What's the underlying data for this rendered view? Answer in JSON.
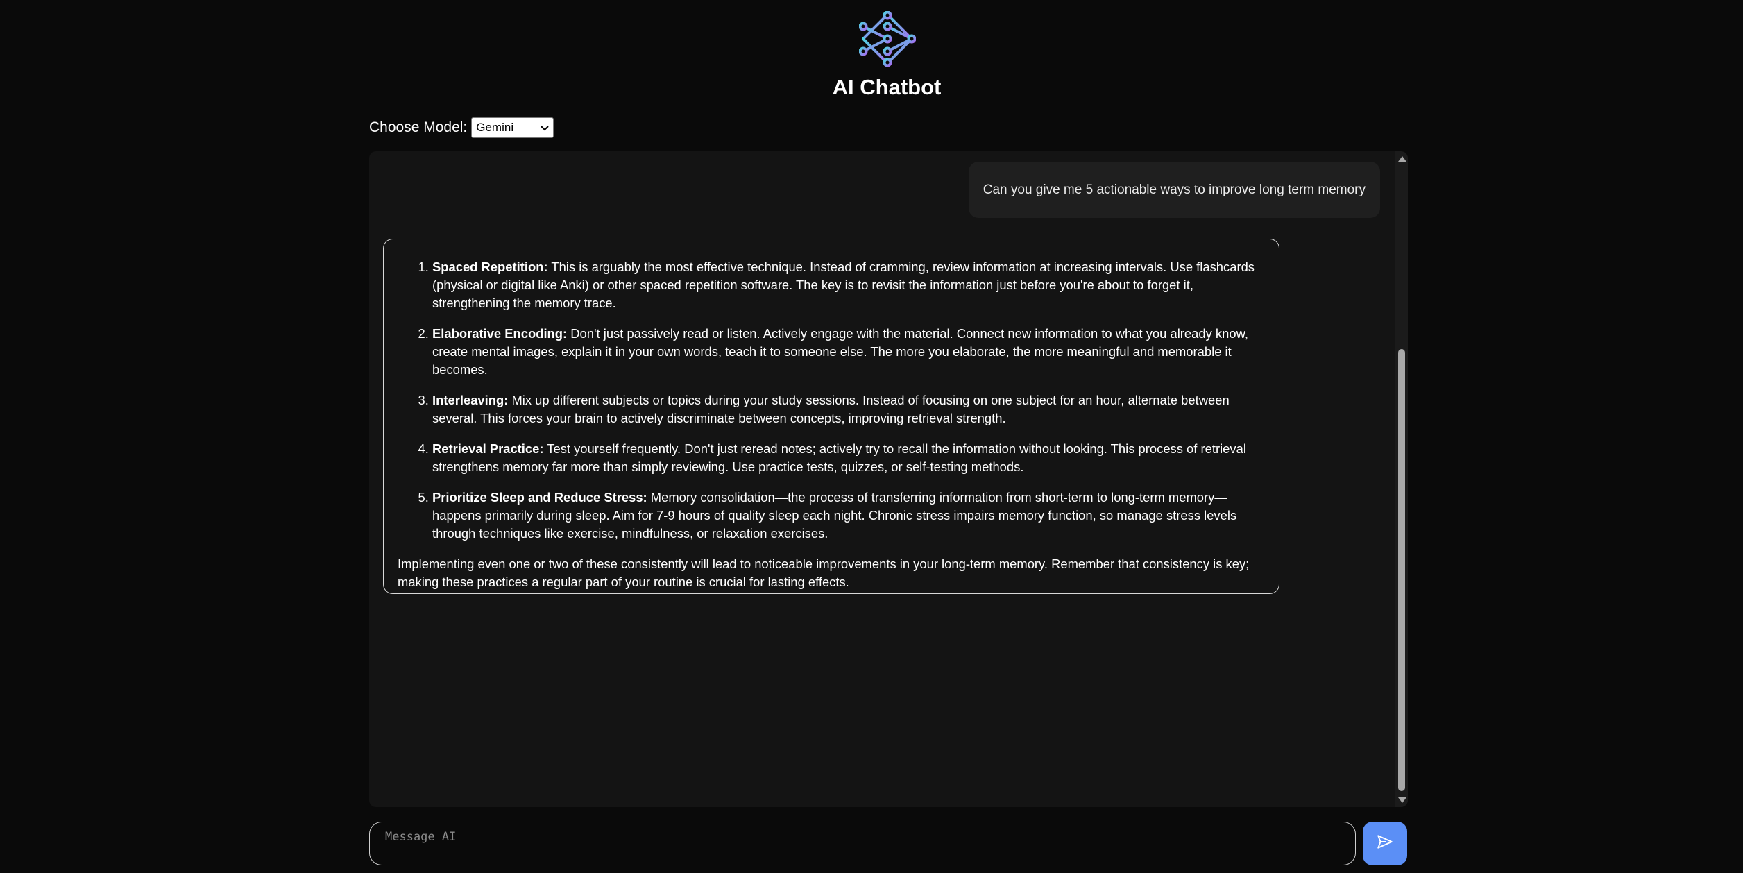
{
  "header": {
    "title": "AI Chatbot",
    "logo_icon": "neural-network-logo-icon"
  },
  "model_selector": {
    "label": "Choose Model:",
    "selected": "Gemini",
    "icon": "chevron-down-icon"
  },
  "chat": {
    "user_message": "Can you give me 5 actionable ways to improve long term memory",
    "ai_response": {
      "items": [
        {
          "title": "Spaced Repetition:",
          "text": " This is arguably the most effective technique. Instead of cramming, review information at increasing intervals. Use flashcards (physical or digital like Anki) or other spaced repetition software. The key is to revisit the information just before you're about to forget it, strengthening the memory trace."
        },
        {
          "title": "Elaborative Encoding:",
          "text": " Don't just passively read or listen. Actively engage with the material. Connect new information to what you already know, create mental images, explain it in your own words, teach it to someone else. The more you elaborate, the more meaningful and memorable it becomes."
        },
        {
          "title": "Interleaving:",
          "text": " Mix up different subjects or topics during your study sessions. Instead of focusing on one subject for an hour, alternate between several. This forces your brain to actively discriminate between concepts, improving retrieval strength."
        },
        {
          "title": "Retrieval Practice:",
          "text": " Test yourself frequently. Don't just reread notes; actively try to recall the information without looking. This process of retrieval strengthens memory far more than simply reviewing. Use practice tests, quizzes, or self-testing methods."
        },
        {
          "title": "Prioritize Sleep and Reduce Stress:",
          "text": " Memory consolidation—the process of transferring information from short-term to long-term memory—happens primarily during sleep. Aim for 7-9 hours of quality sleep each night. Chronic stress impairs memory function, so manage stress levels through techniques like exercise, mindfulness, or relaxation exercises."
        }
      ],
      "closing": "Implementing even one or two of these consistently will lead to noticeable improvements in your long-term memory. Remember that consistency is key; making these practices a regular part of your routine is crucial for lasting effects."
    }
  },
  "composer": {
    "placeholder": "Message AI",
    "value": "",
    "send_icon": "send-icon"
  },
  "colors": {
    "background": "#0a0a0a",
    "chat_panel": "#141414",
    "user_bubble": "#1f1f1f",
    "send_button": "#5b8ff6"
  }
}
